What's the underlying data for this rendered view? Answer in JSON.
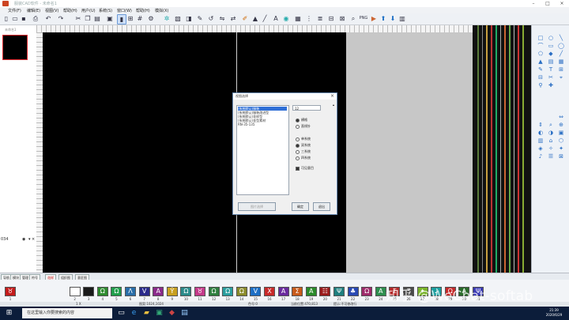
{
  "title_bar": {
    "title": "服装CAD软件 - 未命名1"
  },
  "menu": [
    "文件(F)",
    "编辑(E)",
    "视图(V)",
    "帮助(H)",
    "用户(U)",
    "系统(S)",
    "窗口(W)",
    "帮助(H)",
    "模拟(X)"
  ],
  "toolbar": {
    "zoom_label": "PNG"
  },
  "left_panel": {
    "thumb_label": "未命名1",
    "bottom_number": "034"
  },
  "dialog": {
    "title": "视图选择",
    "list": [
      "(系统默认)服装",
      "(系统默认)服装改进型",
      "(系统默认)花样型",
      "(系统默认)花型素材",
      "RN-35-135"
    ],
    "combo_value": "12",
    "radio1": [
      "横格",
      "直线针"
    ],
    "radio2": [
      "单系统",
      "双系统",
      "三系统",
      "四系统"
    ],
    "checkbox": "可见意目",
    "btn_left": "图片选择",
    "btn_ok": "确定",
    "btn_cancel": "退出"
  },
  "tabs": [
    "导航",
    "模块",
    "管理",
    "符号"
  ],
  "tabs2": [
    "花样",
    "组织图",
    "意匠图"
  ],
  "palette": {
    "numbers": [
      "1",
      "2",
      "3",
      "4",
      "5",
      "6",
      "7",
      "8",
      "9",
      "10",
      "11",
      "12",
      "13",
      "14",
      "15",
      "16",
      "17",
      "18",
      "19",
      "20",
      "21",
      "22",
      "23",
      "24",
      "25",
      "26",
      "27",
      "28",
      "29",
      "30",
      "31"
    ],
    "colors": [
      "#c41c1c",
      "#ffffff",
      "#1a1a1a",
      "#2e8b2e",
      "#1f9e4a",
      "#2a6ea8",
      "#2a2a8a",
      "#8a2a8a",
      "#c8a020",
      "#2a8a8a",
      "#c43a8a",
      "#2e7e3e",
      "#2a9e9e",
      "#8a8a2a",
      "#1c6ec4",
      "#c82a2a",
      "#6a2a9e",
      "#c85a1a",
      "#2a8a2a",
      "#9a1a1a",
      "#1e7e7e",
      "#2a4ab4",
      "#9e2a6a",
      "#2e8e4e",
      "#b42a2a",
      "#4a4a4a",
      "#7ab42a",
      "#1c9e9e",
      "#c42a2a",
      "#2a6a2a",
      "#3a3ab4"
    ]
  },
  "status": {
    "left": "1 X",
    "size": "图案:1024,1024",
    "color": "色号:0",
    "cursor": "当前位置:470,813",
    "hint": "提示:不可修改行"
  },
  "taskbar": {
    "search_placeholder": "在这里输入你要搜索的内容",
    "time": "21:39",
    "date": "2020/6/29"
  },
  "watermark": "知乎 @WeChat-softab"
}
